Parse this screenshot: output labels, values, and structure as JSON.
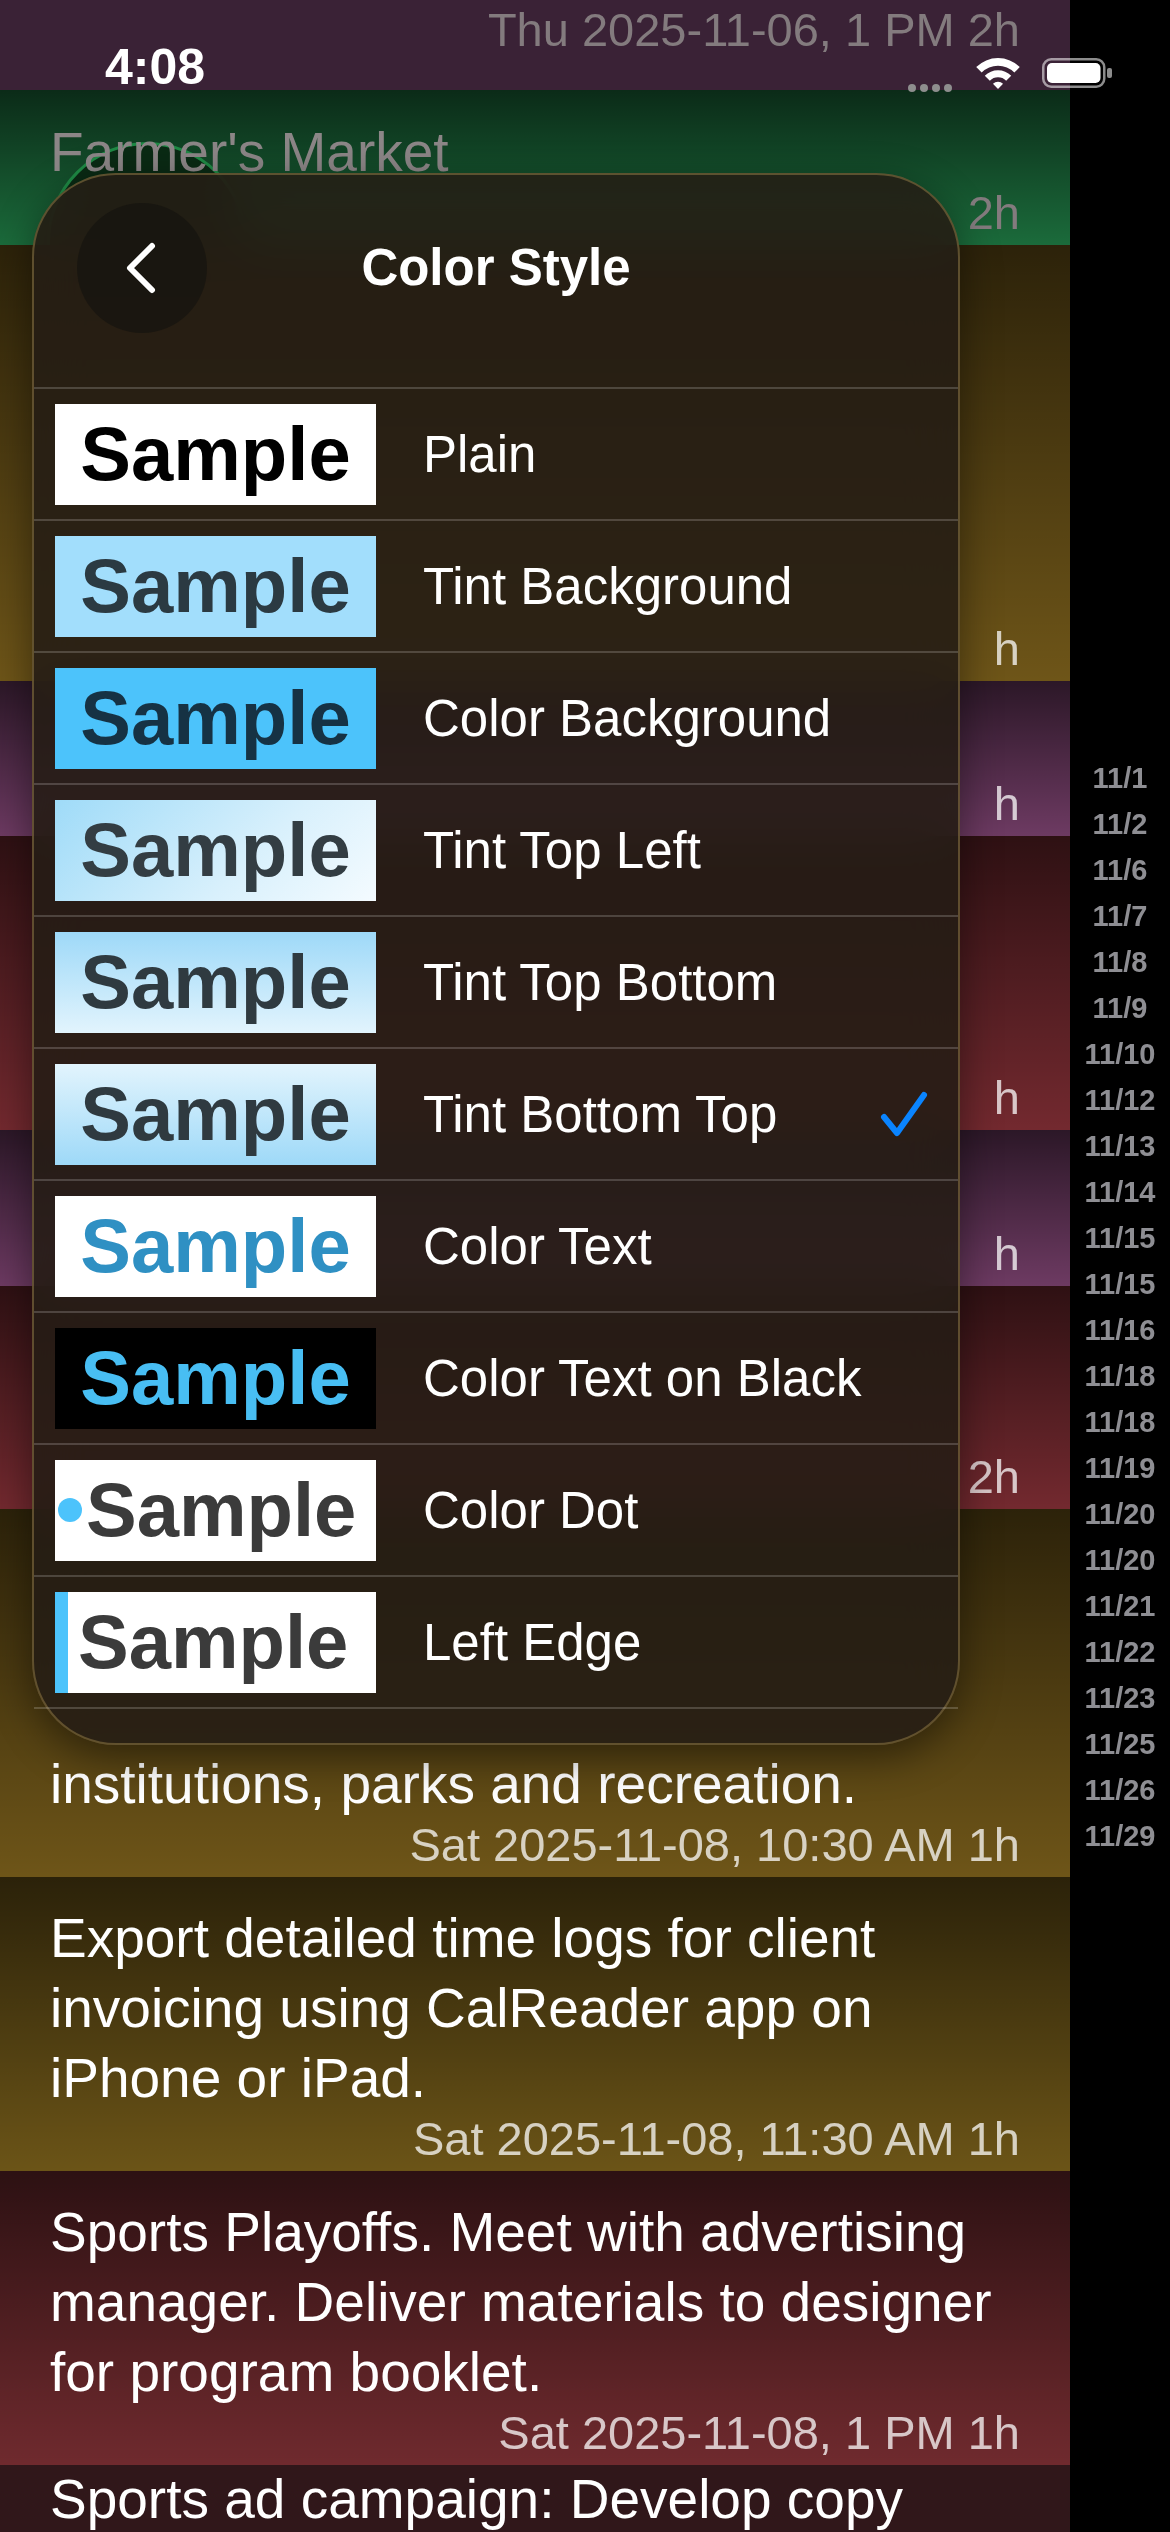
{
  "status_bar": {
    "time": "4:08"
  },
  "events": [
    {
      "when": "Thu 2025-11-06, 1 PM 2h",
      "color": "#3a2236",
      "faded": true
    },
    {
      "text": "Farmer's Market",
      "when": "2h",
      "color": "#1b6b3b",
      "faded": true
    },
    {
      "when": "h",
      "color": "#6e5518",
      "faded": false
    },
    {
      "when": "h",
      "color": "#6d3a62",
      "faded": false
    },
    {
      "when": "h",
      "color": "#73292f",
      "faded": false
    },
    {
      "when": "h",
      "color": "#6d3a62",
      "faded": false
    },
    {
      "when": "2h",
      "color": "#73292f",
      "faded": false
    },
    {
      "text": "institutions, parks and recreation.",
      "when": "Sat 2025-11-08, 10:30 AM 1h",
      "color": "#6e5518",
      "faded": false
    },
    {
      "text": "Export detailed time logs for client invoicing using CalReader app on iPhone or iPad.",
      "when": "Sat 2025-11-08, 11:30 AM 1h",
      "color": "#6b5417",
      "faded": false
    },
    {
      "text": "Sports Playoffs. Meet with advertising manager. Deliver materials to designer for program booklet.",
      "when": "Sat 2025-11-08, 1 PM 1h",
      "color": "#6f2a2e",
      "faded": false
    },
    {
      "text": "Sports ad campaign: Develop copy",
      "color": "#30171a",
      "faded": false
    }
  ],
  "date_index": [
    "11/1",
    "11/2",
    "11/6",
    "11/7",
    "11/8",
    "11/9",
    "11/10",
    "11/12",
    "11/13",
    "11/14",
    "11/15",
    "11/15",
    "11/16",
    "11/18",
    "11/18",
    "11/19",
    "11/20",
    "11/20",
    "11/21",
    "11/22",
    "11/23",
    "11/25",
    "11/26",
    "11/29"
  ],
  "color_style": {
    "title": "Color Style",
    "options": [
      {
        "label": "Plain",
        "sample": "Sample",
        "kind": "plain",
        "selected": false
      },
      {
        "label": "Tint Background",
        "sample": "Sample",
        "kind": "tint_background",
        "selected": false
      },
      {
        "label": "Color Background",
        "sample": "Sample",
        "kind": "color_background",
        "selected": false
      },
      {
        "label": "Tint Top Left",
        "sample": "Sample",
        "kind": "tint_top_left",
        "selected": false
      },
      {
        "label": "Tint Top Bottom",
        "sample": "Sample",
        "kind": "tint_top_bottom",
        "selected": false
      },
      {
        "label": "Tint Bottom Top",
        "sample": "Sample",
        "kind": "tint_bottom_top",
        "selected": true
      },
      {
        "label": "Color Text",
        "sample": "Sample",
        "kind": "color_text",
        "selected": false
      },
      {
        "label": "Color Text on Black",
        "sample": "Sample",
        "kind": "color_text_on_black",
        "selected": false
      },
      {
        "label": "Color Dot",
        "sample": "Sample",
        "kind": "color_dot",
        "selected": false
      },
      {
        "label": "Left Edge",
        "sample": "Sample",
        "kind": "left_edge",
        "selected": false
      }
    ]
  }
}
